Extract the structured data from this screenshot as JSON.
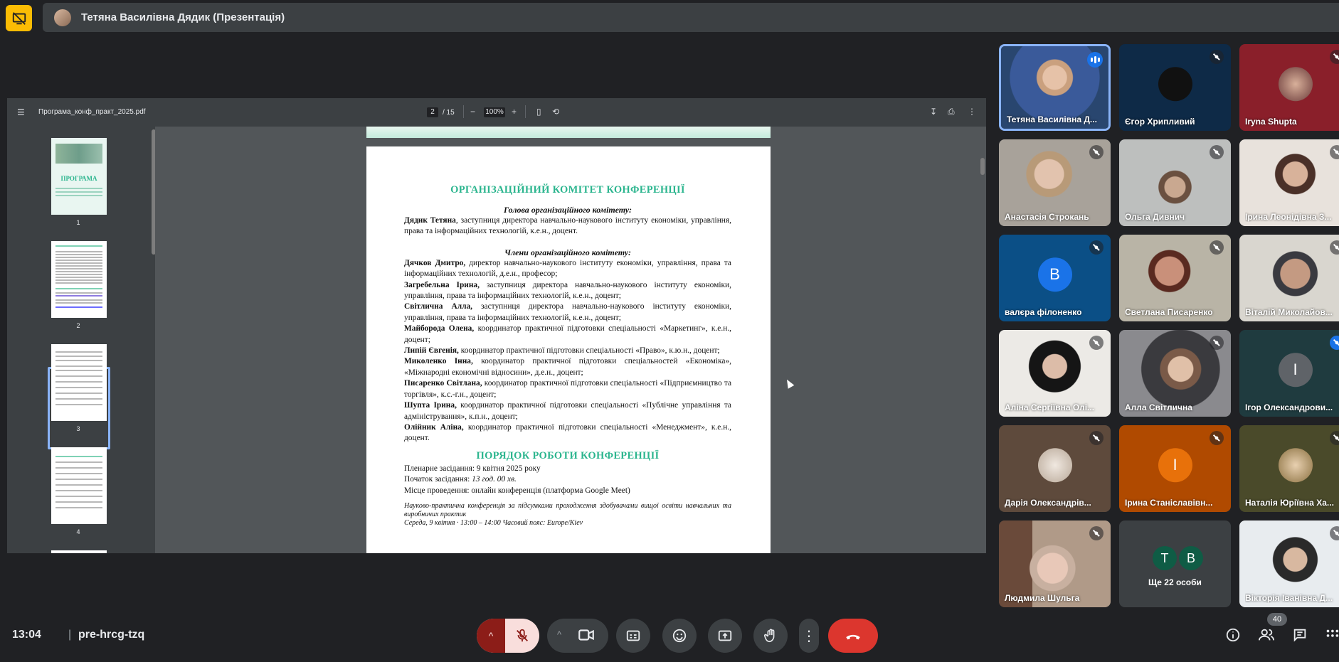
{
  "top_bar": {
    "presenter_label": "Тетяна Василівна Дядик (Презентація)"
  },
  "pdf": {
    "filename": "Програма_конф_практ_2025.pdf",
    "current_page": "2",
    "total_pages": "/ 15",
    "zoom": "100%",
    "thumbnails": [
      {
        "label": "1",
        "title": "ПРОГРАМА"
      },
      {
        "label": "2"
      },
      {
        "label": "3"
      },
      {
        "label": "4"
      }
    ],
    "content": {
      "committee_title": "ОРГАНІЗАЦІЙНИЙ КОМІТЕТ КОНФЕРЕНЦІЇ",
      "head_title": "Голова організаційного комітету:",
      "head_name": "Дядик Тетяна",
      "head_desc": ", заступниця директора навчально-наукового інституту економіки, управління, права та інформаційних технологій, к.е.н., доцент.",
      "members_title": "Члени організаційного комітету:",
      "members": [
        {
          "name": "Дячков Дмитро,",
          "desc": " директор навчально-наукового інституту економіки, управління, права та інформаційних технологій, д.е.н., професор;"
        },
        {
          "name": "Загребельна Ірина,",
          "desc": " заступниця директора навчально-наукового інституту економіки, управління, права та інформаційних технологій, к.е.н., доцент;"
        },
        {
          "name": "Світлична Алла,",
          "desc": " заступниця директора навчально-наукового інституту економіки, управління, права та інформаційних технологій, к.е.н., доцент;"
        },
        {
          "name": "Майборода Олена,",
          "desc": " координатор практичної підготовки спеціальності «Маркетинг», к.е.н., доцент;"
        },
        {
          "name": "Липій Євгенія,",
          "desc": " координатор практичної підготовки спеціальності «Право», к.ю.н., доцент;"
        },
        {
          "name": "Миколенко Інна,",
          "desc": " координатор практичної підготовки спеціальностей «Економіка», «Міжнародні економічні відносини», д.е.н., доцент;"
        },
        {
          "name": "Писаренко Світлана,",
          "desc": " координатор практичної підготовки спеціальності «Підприємництво та торгівля», к.с.-г.н., доцент;"
        },
        {
          "name": "Шупта Ірина,",
          "desc": " координатор практичної підготовки спеціальності «Публічне управління та адміністрування», к.п.н., доцент;"
        },
        {
          "name": "Олійник Аліна,",
          "desc": " координатор практичної підготовки спеціальності «Менеджмент», к.е.н., доцент."
        }
      ],
      "schedule_title": "ПОРЯДОК РОБОТИ КОНФЕРЕНЦІЇ",
      "plenary": "Пленарне засідання: 9 квітня 2025 року",
      "start_label": "Початок засідання: ",
      "start_time": "13 год. 00 хв.",
      "venue": "Місце проведення: онлайн конференція (платформа Google Meet)",
      "note": "Науково-практична конференція за підсумками проходження здобувачами вищої освіти навчальних та виробничих практик",
      "note2": "Середа, 9 квітня · 13:00 – 14:00 Часовий пояс: Europe/Kiev"
    }
  },
  "participants": [
    {
      "name": "Тетяна Василівна Д...",
      "state": "speaking"
    },
    {
      "name": "Єгор Хрипливий",
      "state": "muted"
    },
    {
      "name": "Iryna Shupta",
      "state": "muted"
    },
    {
      "name": "Анастасія Строкань",
      "state": "muted"
    },
    {
      "name": "Ольга Дивнич",
      "state": "muted"
    },
    {
      "name": "Ірина Леонідівна З...",
      "state": "muted"
    },
    {
      "name": "валєра філоненко",
      "state": "muted",
      "initial": "В"
    },
    {
      "name": "Светлана Писаренко",
      "state": "muted"
    },
    {
      "name": "Віталій Миколайов...",
      "state": "muted"
    },
    {
      "name": "Аліна Сергіївна Олі...",
      "state": "muted"
    },
    {
      "name": "Алла Світлична",
      "state": "muted"
    },
    {
      "name": "Ігор Олександрови...",
      "state": "muted",
      "initial": "І"
    },
    {
      "name": "Дарія Олександрів...",
      "state": "muted"
    },
    {
      "name": "Ірина Станіславівн...",
      "state": "muted",
      "initial": "І"
    },
    {
      "name": "Наталія Юріївна Ха...",
      "state": "muted"
    },
    {
      "name": "Людмила Шульга",
      "state": "muted"
    },
    {
      "name": "Ще 22 особи",
      "state": "more",
      "initials": [
        "T",
        "B"
      ]
    },
    {
      "name": "Вікторія Іванівна Д...",
      "state": "muted"
    }
  ],
  "bottom_bar": {
    "time": "13:04",
    "separator": "|",
    "meeting_code": "pre-hrcg-tzq",
    "people_count": "40"
  },
  "colors": {
    "accent_green": "#2bb58e",
    "end_call": "#dc362e",
    "present_badge": "#fbbc04",
    "speaking_blue": "#1a73e8"
  }
}
